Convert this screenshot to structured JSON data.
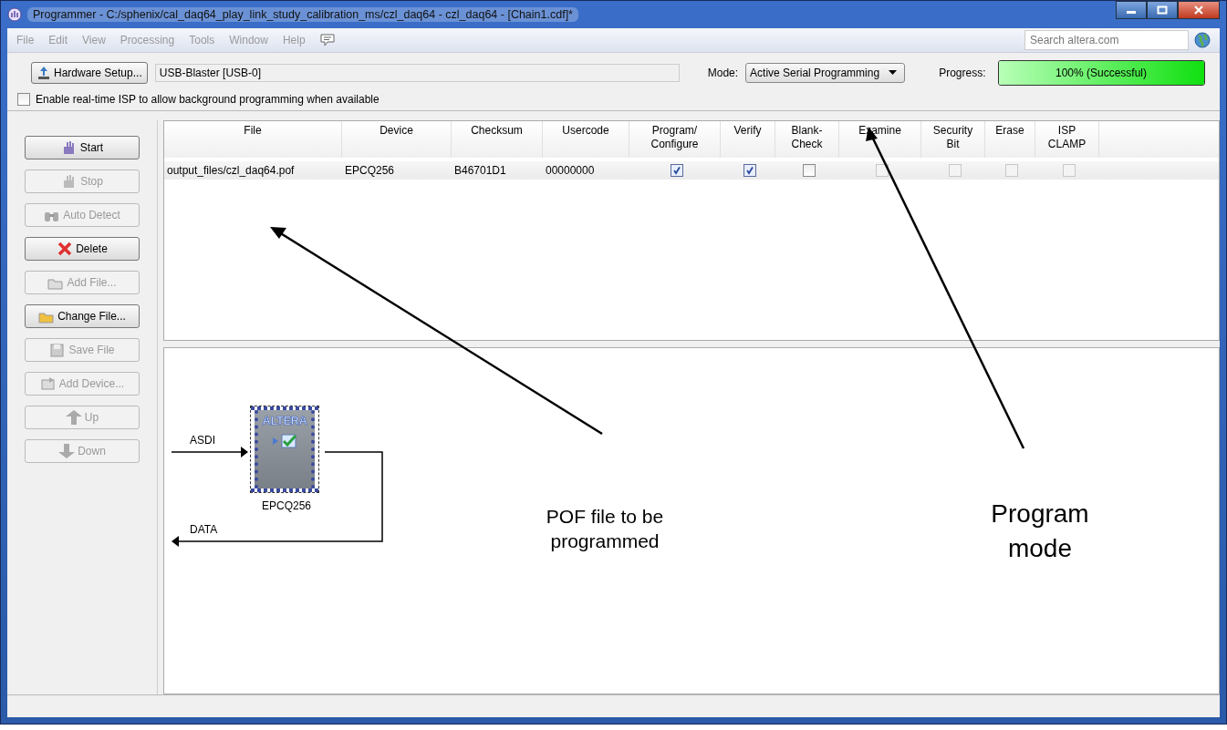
{
  "window": {
    "title": "Programmer - C:/sphenix/cal_daq64_play_link_study_calibration_ms/czl_daq64 - czl_daq64 - [Chain1.cdf]*"
  },
  "menu": [
    "File",
    "Edit",
    "View",
    "Processing",
    "Tools",
    "Window",
    "Help"
  ],
  "search": {
    "placeholder": "Search altera.com"
  },
  "toolbar": {
    "hardware_button": "Hardware Setup...",
    "hardware_value": "USB-Blaster [USB-0]",
    "mode_label": "Mode:",
    "mode_value": "Active Serial Programming",
    "progress_label": "Progress:",
    "progress": {
      "level": 1,
      "text": "100% (Successful)"
    },
    "realtime_isp": {
      "label": "Enable real-time ISP to allow background programming when available",
      "checked": false
    }
  },
  "sidebar": {
    "buttons": [
      {
        "label": "Start",
        "disabled": false
      },
      {
        "label": "Stop",
        "disabled": true
      },
      {
        "label": "Auto Detect",
        "disabled": true
      },
      {
        "label": "Delete",
        "disabled": false
      },
      {
        "label": "Add File...",
        "disabled": true
      },
      {
        "label": "Change File...",
        "disabled": false
      },
      {
        "label": "Save File",
        "disabled": true
      },
      {
        "label": "Add Device...",
        "disabled": true
      },
      {
        "label": "Up",
        "disabled": true
      },
      {
        "label": "Down",
        "disabled": true
      }
    ]
  },
  "table": {
    "columns": [
      "File",
      "Device",
      "Checksum",
      "Usercode",
      "Program/ Configure",
      "Verify",
      "Blank- Check",
      "Examine",
      "Security Bit",
      "Erase",
      "ISP CLAMP"
    ],
    "rows": [
      {
        "selected": false,
        "cells": [
          {
            "kind": "text",
            "text": "output_files/czl_daq64.pof"
          },
          {
            "kind": "text",
            "text": "EPCQ256"
          },
          {
            "kind": "text",
            "text": "B46701D1"
          },
          {
            "kind": "text",
            "text": "00000000"
          },
          {
            "kind": "checkbox",
            "checked": true,
            "disabled": false
          },
          {
            "kind": "checkbox",
            "checked": true,
            "disabled": false
          },
          {
            "kind": "checkbox",
            "checked": false,
            "disabled": false
          },
          {
            "kind": "checkbox",
            "checked": false,
            "disabled": true
          },
          {
            "kind": "checkbox",
            "checked": false,
            "disabled": true
          },
          {
            "kind": "checkbox",
            "checked": false,
            "disabled": true
          },
          {
            "kind": "checkbox",
            "checked": false,
            "disabled": true
          }
        ]
      }
    ]
  },
  "diagram": {
    "chip_logo": "ALTERA",
    "chip_name": "EPCQ256",
    "input_label": "ASDI",
    "output_label": "DATA"
  },
  "annotations": [
    {
      "text": "POF file to be programmed"
    },
    {
      "text": "Program mode"
    }
  ]
}
